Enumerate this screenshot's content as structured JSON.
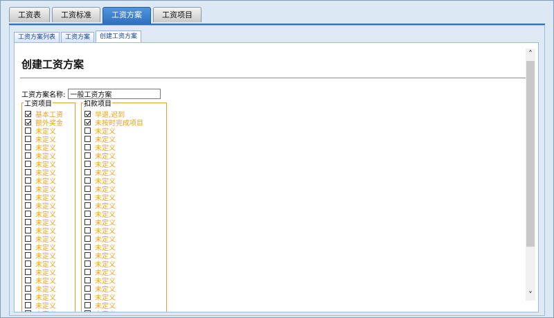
{
  "top_tabs": [
    {
      "label": "工资表"
    },
    {
      "label": "工资标准"
    },
    {
      "label": "工资方案"
    },
    {
      "label": "工资项目"
    }
  ],
  "active_top_tab": "工资方案",
  "sub_tabs": [
    {
      "label": "工资方案列表"
    },
    {
      "label": "工资方案"
    },
    {
      "label": "创建工资方案"
    }
  ],
  "page": {
    "title": "创建工资方案",
    "name_label": "工资方案名称:",
    "name_value": "一般工资方案"
  },
  "salary_items": {
    "legend": "工资项目",
    "items": [
      {
        "label": "基本工资",
        "checked": true
      },
      {
        "label": "额外奖金",
        "checked": true
      },
      {
        "label": "未定义",
        "checked": false
      },
      {
        "label": "未定义",
        "checked": false
      },
      {
        "label": "未定义",
        "checked": false
      },
      {
        "label": "未定义",
        "checked": false
      },
      {
        "label": "未定义",
        "checked": false
      },
      {
        "label": "未定义",
        "checked": false
      },
      {
        "label": "未定义",
        "checked": false
      },
      {
        "label": "未定义",
        "checked": false
      },
      {
        "label": "未定义",
        "checked": false
      },
      {
        "label": "未定义",
        "checked": false
      },
      {
        "label": "未定义",
        "checked": false
      },
      {
        "label": "未定义",
        "checked": false
      },
      {
        "label": "未定义",
        "checked": false
      },
      {
        "label": "未定义",
        "checked": false
      },
      {
        "label": "未定义",
        "checked": false
      },
      {
        "label": "未定义",
        "checked": false
      },
      {
        "label": "未定义",
        "checked": false
      },
      {
        "label": "未定义",
        "checked": false
      },
      {
        "label": "未定义",
        "checked": false
      },
      {
        "label": "未定义",
        "checked": false
      },
      {
        "label": "未定义",
        "checked": false
      },
      {
        "label": "未定义",
        "checked": false
      },
      {
        "label": "未定义",
        "checked": false
      }
    ]
  },
  "deduction_items": {
    "legend": "扣款项目",
    "items": [
      {
        "label": "早退,迟到",
        "checked": true
      },
      {
        "label": "未按时完成项目",
        "checked": true
      },
      {
        "label": "未定义",
        "checked": false
      },
      {
        "label": "未定义",
        "checked": false
      },
      {
        "label": "未定义",
        "checked": false
      },
      {
        "label": "未定义",
        "checked": false
      },
      {
        "label": "未定义",
        "checked": false
      },
      {
        "label": "未定义",
        "checked": false
      },
      {
        "label": "未定义",
        "checked": false
      },
      {
        "label": "未定义",
        "checked": false
      },
      {
        "label": "未定义",
        "checked": false
      },
      {
        "label": "未定义",
        "checked": false
      },
      {
        "label": "未定义",
        "checked": false
      },
      {
        "label": "未定义",
        "checked": false
      },
      {
        "label": "未定义",
        "checked": false
      },
      {
        "label": "未定义",
        "checked": false
      },
      {
        "label": "未定义",
        "checked": false
      },
      {
        "label": "未定义",
        "checked": false
      },
      {
        "label": "未定义",
        "checked": false
      },
      {
        "label": "未定义",
        "checked": false
      },
      {
        "label": "未定义",
        "checked": false
      },
      {
        "label": "未定义",
        "checked": false
      },
      {
        "label": "未定义",
        "checked": false
      },
      {
        "label": "未定义",
        "checked": false
      },
      {
        "label": "未定义",
        "checked": false
      }
    ]
  },
  "scrollbar": {
    "up_icon": "chevron-up-icon",
    "down_icon": "chevron-down-icon"
  },
  "colors": {
    "accent": "#2f6fbe",
    "item_text": "#e8a020",
    "fieldset_border": "#e0a030"
  }
}
